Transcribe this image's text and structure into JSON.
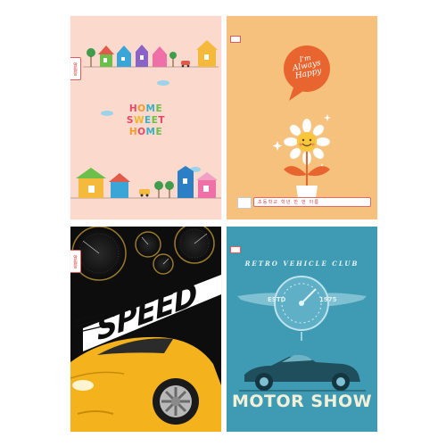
{
  "covers": [
    {
      "id": "home",
      "spine_label": "알림장",
      "title_lines": [
        [
          [
            "H",
            "#e7486a"
          ],
          [
            "O",
            "#f29a2e"
          ],
          [
            "M",
            "#3bb0c9"
          ],
          [
            "E",
            "#6cbf4a"
          ]
        ],
        [
          [
            "S",
            "#e7486a"
          ],
          [
            "W",
            "#f2b52e"
          ],
          [
            "E",
            "#3bb0c9"
          ],
          [
            "E",
            "#6cbf4a"
          ],
          [
            "T",
            "#e7486a"
          ]
        ],
        [
          [
            "H",
            "#f29a2e"
          ],
          [
            "O",
            "#e7486a"
          ],
          [
            "M",
            "#3bb0c9"
          ],
          [
            "E",
            "#6cbf4a"
          ]
        ]
      ],
      "colors": {
        "background": "#fbd9cc"
      }
    },
    {
      "id": "happy",
      "spine_label": "알림장",
      "bubble_text_lines": [
        "I'm",
        "Always",
        "Happy"
      ],
      "name_line": "초등학교 학년 반 번 이름",
      "colors": {
        "background": "#f6c17d",
        "bubble": "#e8652f"
      }
    },
    {
      "id": "speed",
      "spine_label": "알림장",
      "word": "SPEED",
      "colors": {
        "background": "#0d0d0d",
        "car": "#f4b21c"
      }
    },
    {
      "id": "motor",
      "spine_label": "알림장",
      "club_text": "RETRO VEHICLE CLUB",
      "estd": "ESTD",
      "year": "1975",
      "title": "MOTOR SHOW",
      "colors": {
        "background": "#3e9bb3",
        "car": "#1f4f5c"
      }
    }
  ]
}
